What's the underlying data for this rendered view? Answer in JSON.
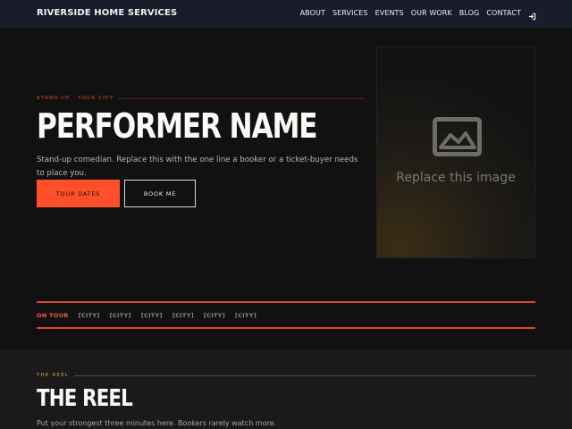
{
  "nav": {
    "brand": "RIVERSIDE HOME SERVICES",
    "items": [
      {
        "label": "ABOUT"
      },
      {
        "label": "SERVICES"
      },
      {
        "label": "EVENTS"
      },
      {
        "label": "OUR WORK"
      },
      {
        "label": "BLOG"
      },
      {
        "label": "CONTACT"
      }
    ],
    "login_icon": "login-icon"
  },
  "hero": {
    "kicker": "STAND-UP · YOUR CITY",
    "title": "PERFORMER NAME",
    "description": "Stand-up comedian. Replace this with the one line a booker or a ticket-buyer needs to place you.",
    "primary_button": "TOUR DATES",
    "secondary_button": "BOOK ME",
    "image_placeholder_text": "Replace this image",
    "image_icon": "image-icon"
  },
  "tour": {
    "label": "ON TOUR",
    "cities": [
      "[CITY]",
      "[CITY]",
      "[CITY]",
      "[CITY]",
      "[CITY]",
      "[CITY]"
    ]
  },
  "reel": {
    "kicker": "THE REEL",
    "title": "THE REEL",
    "description": "Put your strongest three minutes here. Bookers rarely watch more."
  },
  "colors": {
    "accent": "#ff4f2b",
    "nav_background": "#1a1b2b",
    "page_background": "#121112",
    "reel_accent": "#d9a334"
  }
}
